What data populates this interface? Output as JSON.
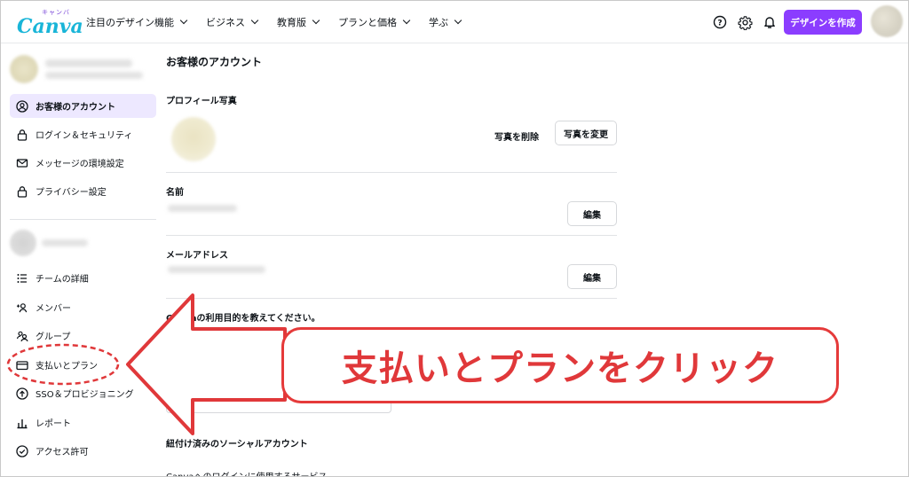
{
  "app": {
    "logo_sub": "キャンバ",
    "logo_main": "Canva"
  },
  "header": {
    "nav": [
      {
        "label": "注目のデザイン機能"
      },
      {
        "label": "ビジネス"
      },
      {
        "label": "教育版"
      },
      {
        "label": "プランと価格"
      },
      {
        "label": "学ぶ"
      }
    ],
    "create_button": "デザインを作成"
  },
  "sidebar": {
    "account_items": [
      {
        "label": "お客様のアカウント",
        "icon": "user-circle-icon",
        "active": true
      },
      {
        "label": "ログイン＆セキュリティ",
        "icon": "lock-icon"
      },
      {
        "label": "メッセージの環境設定",
        "icon": "mail-icon"
      },
      {
        "label": "プライバシー設定",
        "icon": "lock-icon"
      }
    ],
    "team_items": [
      {
        "label": "チームの詳細",
        "icon": "list-icon"
      },
      {
        "label": "メンバー",
        "icon": "add-people-icon"
      },
      {
        "label": "グループ",
        "icon": "group-icon"
      },
      {
        "label": "支払いとプラン",
        "icon": "credit-card-icon"
      },
      {
        "label": "SSO＆プロビジョニング",
        "icon": "cloud-upload-icon"
      },
      {
        "label": "レポート",
        "icon": "bar-chart-icon"
      },
      {
        "label": "アクセス許可",
        "icon": "check-circle-icon"
      }
    ]
  },
  "main": {
    "title": "お客様のアカウント",
    "profile_photo": {
      "label": "プロフィール写真",
      "delete": "写真を削除",
      "change": "写真を変更"
    },
    "name": {
      "label": "名前",
      "edit": "編集"
    },
    "email": {
      "label": "メールアドレス",
      "edit": "編集"
    },
    "purpose": {
      "label": "Canvaの利用目的を教えてください。",
      "partial": "C"
    },
    "social": {
      "label": "紐付け済みのソーシャルアカウント",
      "sub": "Canvaへのログインに使用するサービス"
    }
  },
  "annotation": {
    "callout": "支払いとプランをクリック",
    "color": "#e0383a"
  }
}
